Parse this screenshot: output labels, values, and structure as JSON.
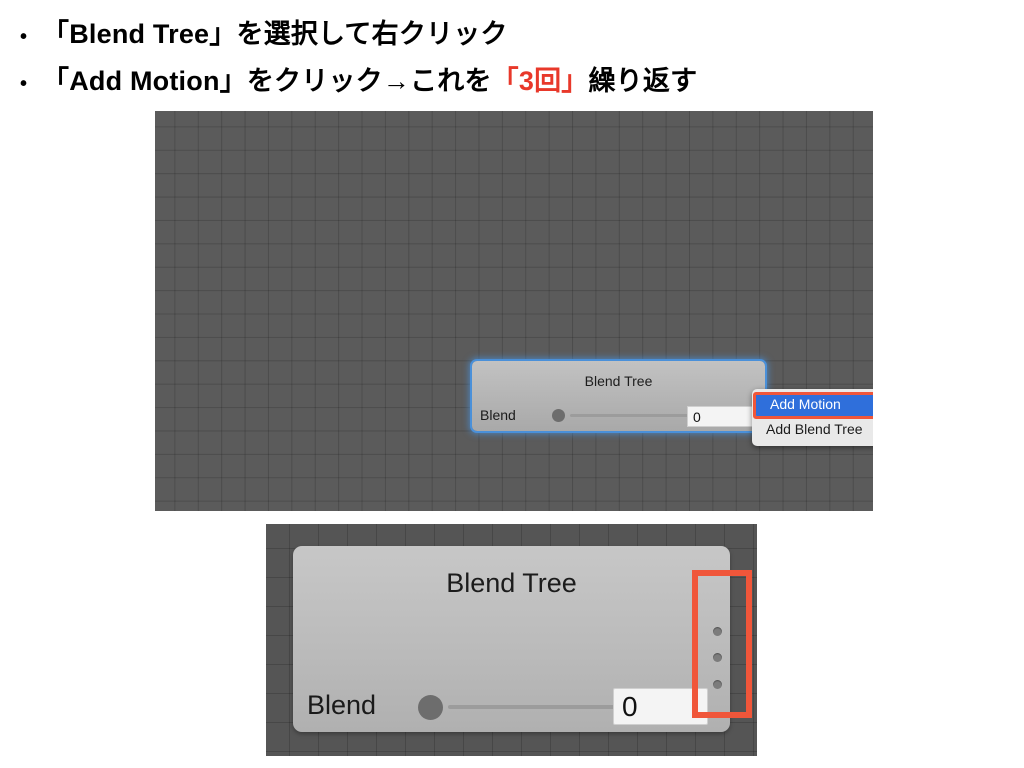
{
  "slide": {
    "bullets": [
      {
        "marker": "•",
        "segments": [
          {
            "text": "「Blend Tree」を選択して右クリック",
            "color": "normal"
          }
        ],
        "plain": "「Blend Tree」を選択して右クリック"
      },
      {
        "marker": "•",
        "segments": [
          {
            "text": "「Add Motion」をクリック→これを",
            "color": "normal"
          },
          {
            "text": "「3回」",
            "color": "red"
          },
          {
            "text": "繰り返す",
            "color": "normal"
          }
        ],
        "plain": "「Add Motion」をクリック→これを「3回」繰り返す"
      }
    ],
    "bullet_1_pre": "「Add Motion」をクリック→これを",
    "bullet_1_accent": "「3回」",
    "bullet_1_post": "繰り返す"
  },
  "colors": {
    "accent_red": "#E8382A",
    "highlight_orange": "#F0563A",
    "selection_blue": "#4A90D9",
    "menu_select_blue": "#2F6FDB",
    "grid_background": "#5B5B5B",
    "node_body": "#BCBCBC"
  },
  "screenshot_top": {
    "name": "Unity Animator Blend Tree graph with context menu",
    "node": {
      "title": "Blend Tree",
      "parameter_label": "Blend",
      "parameter_value": "0",
      "selected": true
    },
    "context_menu": {
      "items": [
        {
          "label": "Add Motion",
          "selected": true
        },
        {
          "label": "Add Blend Tree",
          "selected": false
        }
      ]
    }
  },
  "screenshot_bottom": {
    "name": "Zoomed Blend Tree node after adding three motions",
    "node": {
      "title": "Blend Tree",
      "parameter_label": "Blend",
      "parameter_value": "0"
    },
    "motion_slot_count": 3,
    "motion_slots": [
      "motion-slot-1",
      "motion-slot-2",
      "motion-slot-3"
    ]
  }
}
